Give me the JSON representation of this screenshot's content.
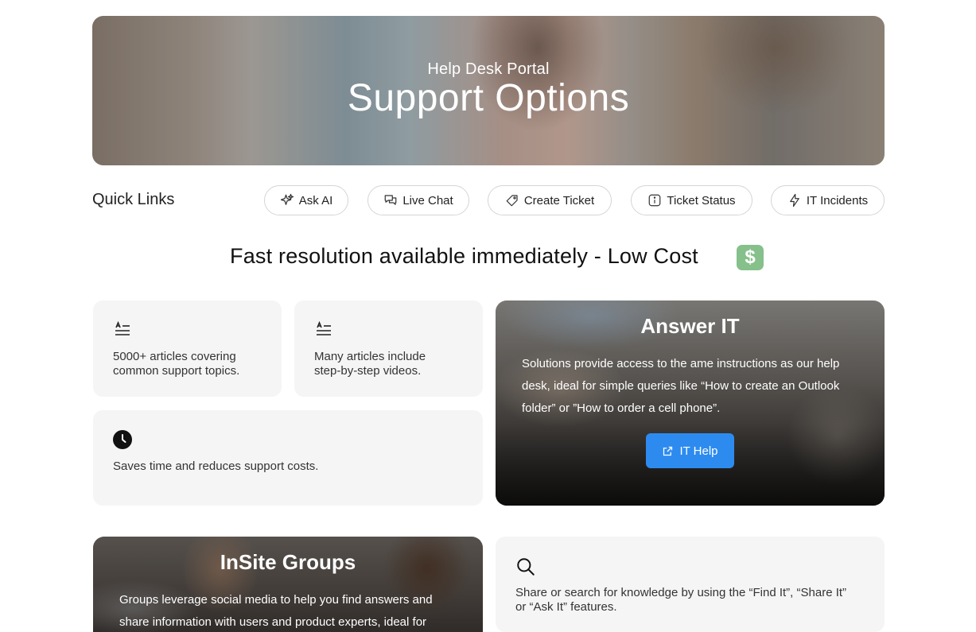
{
  "hero": {
    "subtitle": "Help Desk Portal",
    "title": "Support Options"
  },
  "quick_links": {
    "label": "Quick Links",
    "items": [
      {
        "label": "Ask AI",
        "icon": "sparkle-icon"
      },
      {
        "label": "Live Chat",
        "icon": "chat-icon"
      },
      {
        "label": "Create Ticket",
        "icon": "tag-icon"
      },
      {
        "label": "Ticket Status",
        "icon": "info-icon"
      },
      {
        "label": "IT Incidents",
        "icon": "bolt-icon"
      }
    ]
  },
  "headline": {
    "text": "Fast resolution available immediately - Low Cost",
    "badge": "$",
    "badge_color": "#86c08a"
  },
  "features": [
    {
      "text_line1": "5000+ articles covering",
      "text_line2": "common support topics.",
      "icon": "text-lines-icon"
    },
    {
      "text_line1": "Many articles include",
      "text_line2": "step-by-step videos.",
      "icon": "text-lines-icon"
    },
    {
      "text_line1": "Saves time and reduces support costs.",
      "text_line2": "",
      "icon": "clock-icon"
    }
  ],
  "answer_it": {
    "title": "Answer IT",
    "line1": "Solutions provide access to the ame instructions as our help",
    "line2": "desk, ideal for simple queries like “How to create an Outlook",
    "line3": "folder” or ”How to order a cell phone”.",
    "button_label": "IT Help",
    "button_color": "#2d8bf0"
  },
  "insite_groups": {
    "title": "InSite Groups",
    "line1": "Groups leverage social media to help you find answers and",
    "line2": "share information with users and product experts, ideal for"
  },
  "search_card": {
    "line1": "Share or search for knowledge by using the “Find It”, “Share It”",
    "line2": "or “Ask It” features.",
    "icon": "search-icon"
  }
}
